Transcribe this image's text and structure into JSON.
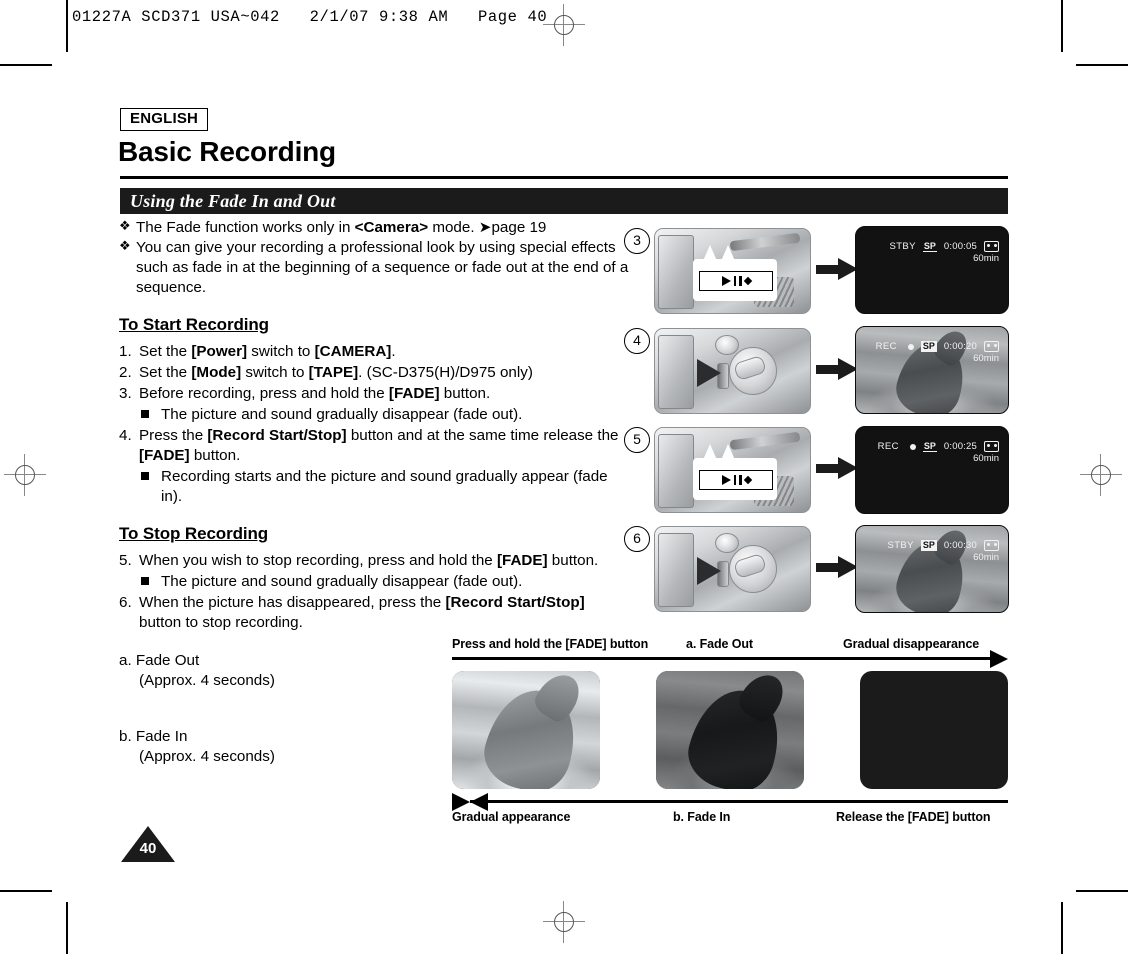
{
  "running_head": "01227A SCD371 USA~042   2/1/07 9:38 AM   Page 40",
  "language_badge": "ENGLISH",
  "page_title": "Basic Recording",
  "section_title": "Using the Fade In and Out",
  "intro_bullets": [
    "The Fade function works only in <Camera> mode. ➜page 19",
    "You can give your recording a professional look by using special effects such as fade in at the beginning of a sequence or fade out at the end of a sequence."
  ],
  "start_heading": "To Start Recording",
  "start_steps": [
    {
      "num": "1.",
      "text": "Set the [Power] switch to [CAMERA]."
    },
    {
      "num": "2.",
      "text": "Set the [Mode] switch to [TAPE]. (SC-D375(H)/D975 only)"
    },
    {
      "num": "3.",
      "text": "Before recording, press and hold the [FADE] button."
    },
    {
      "num": "4.",
      "text": "Press the [Record Start/Stop] button and at the same time release the [FADE] button."
    }
  ],
  "start_substeps": {
    "after_3": "The picture and sound gradually disappear (fade out).",
    "after_4": "Recording starts and the picture and sound gradually appear (fade in)."
  },
  "stop_heading": "To Stop Recording",
  "stop_steps": [
    {
      "num": "5.",
      "text": "When you wish to stop recording, press and hold the [FADE] button."
    },
    {
      "num": "6.",
      "text": "When the picture has disappeared, press the [Record Start/Stop] button to stop recording."
    }
  ],
  "stop_substeps": {
    "after_5": "The picture and sound gradually disappear (fade out)."
  },
  "fade_notes": [
    {
      "label": "a. Fade Out",
      "detail": "(Approx. 4 seconds)"
    },
    {
      "label": "b. Fade In",
      "detail": "(Approx. 4 seconds)"
    }
  ],
  "page_number": "40",
  "sequence": [
    {
      "badge": "3",
      "camera_view": "side-fade-button-callout",
      "lcd": {
        "mode": "STBY",
        "rec_dot": false,
        "quality": "SP",
        "quality_highlighted": false,
        "timecode": "0:00:05",
        "tape_remaining": "60min",
        "image": "black"
      }
    },
    {
      "badge": "4",
      "camera_view": "rear-record-start-stop",
      "lcd": {
        "mode": "REC",
        "rec_dot": true,
        "quality": "SP",
        "quality_highlighted": true,
        "timecode": "0:00:20",
        "tape_remaining": "60min",
        "image": "dolphin"
      }
    },
    {
      "badge": "5",
      "camera_view": "side-fade-button-callout",
      "lcd": {
        "mode": "REC",
        "rec_dot": true,
        "quality": "SP",
        "quality_highlighted": false,
        "timecode": "0:00:25",
        "tape_remaining": "60min",
        "image": "black"
      }
    },
    {
      "badge": "6",
      "camera_view": "rear-record-start-stop",
      "lcd": {
        "mode": "STBY",
        "rec_dot": false,
        "quality": "SP",
        "quality_highlighted": true,
        "timecode": "0:00:30",
        "tape_remaining": "60min",
        "image": "dolphin"
      }
    }
  ],
  "filmstrip": {
    "top_captions": [
      "Press and hold the [FADE] button",
      "a. Fade Out",
      "Gradual disappearance"
    ],
    "bottom_captions": [
      "Gradual appearance",
      "b. Fade In",
      "Release the [FADE] button"
    ],
    "frames": [
      "bright-dolphin",
      "dark-dolphin",
      "black"
    ]
  }
}
